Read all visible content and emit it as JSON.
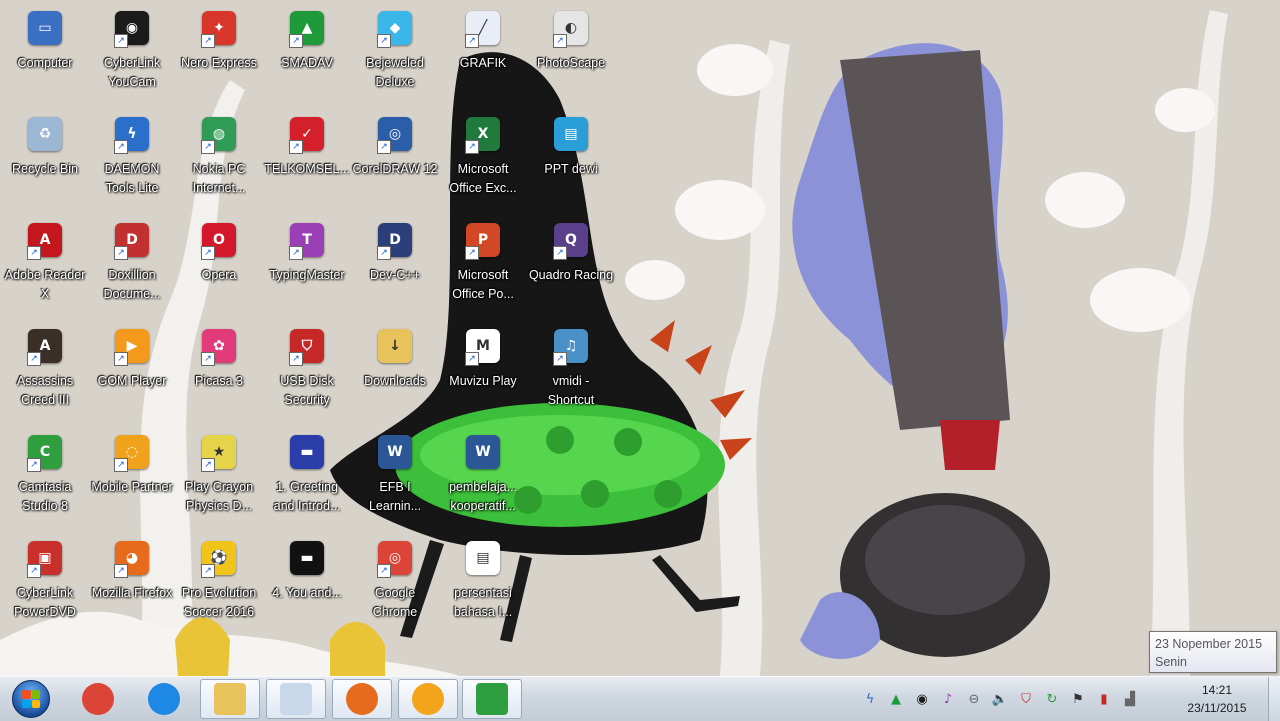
{
  "desktop": {
    "icons": [
      {
        "label": "Computer",
        "icon": "computer-icon",
        "color": "#3b6fc2",
        "glyph": "▭"
      },
      {
        "label": "CyberLink YouCam",
        "icon": "cyberlink-youcam-icon",
        "color": "#1b1b1b",
        "glyph": "◉"
      },
      {
        "label": "Nero Express",
        "icon": "nero-express-icon",
        "color": "#d8362a",
        "glyph": "✦"
      },
      {
        "label": "SMADAV",
        "icon": "smadav-icon",
        "color": "#1f9a3b",
        "glyph": "▲"
      },
      {
        "label": "Bejeweled Deluxe",
        "icon": "bejeweled-icon",
        "color": "#3bb6e8",
        "glyph": "◆"
      },
      {
        "label": "GRAFIK",
        "icon": "grafik-icon",
        "color": "#e9eef6",
        "glyph": "╱"
      },
      {
        "label": "PhotoScape",
        "icon": "photoscape-icon",
        "color": "#e5e5e5",
        "glyph": "◐"
      },
      {
        "label": "Recycle Bin",
        "icon": "recycle-bin-icon",
        "color": "#9bb7d4",
        "glyph": "♻"
      },
      {
        "label": "DAEMON Tools Lite",
        "icon": "daemon-tools-icon",
        "color": "#2a6fc9",
        "glyph": "ϟ"
      },
      {
        "label": "Nokia PC Internet...",
        "icon": "nokia-pc-icon",
        "color": "#2f9b54",
        "glyph": "◍"
      },
      {
        "label": "TELKOMSEL...",
        "icon": "telkomsel-icon",
        "color": "#d4202b",
        "glyph": "✓"
      },
      {
        "label": "CorelDRAW 12",
        "icon": "coreldraw-icon",
        "color": "#2c5da8",
        "glyph": "◎"
      },
      {
        "label": "Microsoft Office Exc...",
        "icon": "excel-icon",
        "color": "#1f7a3c",
        "glyph": "X"
      },
      {
        "label": "PPT dewi",
        "icon": "ppt-folder-icon",
        "color": "#2a9ed6",
        "glyph": "▤"
      },
      {
        "label": "Adobe Reader X",
        "icon": "adobe-reader-icon",
        "color": "#c4171d",
        "glyph": "A"
      },
      {
        "label": "Doxillion Docume...",
        "icon": "doxillion-icon",
        "color": "#c23030",
        "glyph": "D"
      },
      {
        "label": "Opera",
        "icon": "opera-icon",
        "color": "#d3182c",
        "glyph": "O"
      },
      {
        "label": "TypingMaster",
        "icon": "typingmaster-icon",
        "color": "#9b3fb7",
        "glyph": "T"
      },
      {
        "label": "Dev-C++",
        "icon": "dev-cpp-icon",
        "color": "#2b3f7a",
        "glyph": "D"
      },
      {
        "label": "Microsoft Office Po...",
        "icon": "powerpoint-icon",
        "color": "#d24726",
        "glyph": "P"
      },
      {
        "label": "Quadro Racing",
        "icon": "quadro-racing-icon",
        "color": "#5a3f8a",
        "glyph": "Q"
      },
      {
        "label": "Assassins Creed III",
        "icon": "assassins-creed-icon",
        "color": "#3a2f26",
        "glyph": "A"
      },
      {
        "label": "GOM Player",
        "icon": "gom-player-icon",
        "color": "#f39a1c",
        "glyph": "▶"
      },
      {
        "label": "Picasa 3",
        "icon": "picasa-icon",
        "color": "#e23b7a",
        "glyph": "✿"
      },
      {
        "label": "USB Disk Security",
        "icon": "usb-security-icon",
        "color": "#c62828",
        "glyph": "⛉"
      },
      {
        "label": "Downloads",
        "icon": "downloads-folder-icon",
        "color": "#e8c25a",
        "glyph": "↓"
      },
      {
        "label": "Muvizu Play",
        "icon": "muvizu-icon",
        "color": "#ffffff",
        "glyph": "M"
      },
      {
        "label": "vmidi - Shortcut",
        "icon": "vmidi-icon",
        "color": "#4a90c8",
        "glyph": "♫"
      },
      {
        "label": "Camtasia Studio 8",
        "icon": "camtasia-icon",
        "color": "#2e9e3e",
        "glyph": "C"
      },
      {
        "label": "Mobile Partner",
        "icon": "mobile-partner-icon",
        "color": "#f0a21c",
        "glyph": "◌"
      },
      {
        "label": "Play Crayon Physics D...",
        "icon": "crayon-physics-icon",
        "color": "#e5d34a",
        "glyph": "★"
      },
      {
        "label": "1. Greeting and Introd...",
        "icon": "video-file-icon",
        "color": "#2b3da8",
        "glyph": "▬"
      },
      {
        "label": "EFB I Learnin...",
        "icon": "word-doc-icon",
        "color": "#2b5797",
        "glyph": "W"
      },
      {
        "label": "pembelaja... kooperatif...",
        "icon": "word-doc-icon-2",
        "color": "#2b5797",
        "glyph": "W"
      },
      {
        "label": "CyberLink PowerDVD",
        "icon": "powerdvd-icon",
        "color": "#c9302c",
        "glyph": "▣"
      },
      {
        "label": "Mozilla Firefox",
        "icon": "firefox-icon",
        "color": "#e66b1c",
        "glyph": "◕"
      },
      {
        "label": "Pro Evolution Soccer 2016",
        "icon": "pes-2016-icon",
        "color": "#f0c419",
        "glyph": "⚽"
      },
      {
        "label": "4. You and...",
        "icon": "video-file-icon-2",
        "color": "#111111",
        "glyph": "▬"
      },
      {
        "label": "Google Chrome",
        "icon": "chrome-icon",
        "color": "#db4437",
        "glyph": "◎"
      },
      {
        "label": "persentasi bahasa I...",
        "icon": "pdf-doc-icon",
        "color": "#ffffff",
        "glyph": "▤"
      }
    ]
  },
  "taskbar": {
    "pinned": [
      {
        "name": "chrome",
        "icon": "chrome-taskbar-icon",
        "color": "#db4437"
      },
      {
        "name": "internet-explorer",
        "icon": "ie-taskbar-icon",
        "color": "#1e88e5"
      },
      {
        "name": "explorer",
        "icon": "folder-taskbar-icon",
        "color": "#e8c25a"
      },
      {
        "name": "grafik",
        "icon": "grafik-taskbar-icon",
        "color": "#c9d7ea"
      },
      {
        "name": "firefox",
        "icon": "firefox-taskbar-icon",
        "color": "#e66b1c"
      },
      {
        "name": "winamp",
        "icon": "winamp-taskbar-icon",
        "color": "#f2a51a"
      },
      {
        "name": "camtasia",
        "icon": "camtasia-taskbar-icon",
        "color": "#2e9e3e"
      }
    ],
    "tray": [
      {
        "icon": "daemon-tray-icon",
        "glyph": "ϟ",
        "color": "#2a6fc9"
      },
      {
        "icon": "smadav-tray-icon",
        "glyph": "▲",
        "color": "#1f9a3b"
      },
      {
        "icon": "youcam-tray-icon",
        "glyph": "◉",
        "color": "#1b1b1b"
      },
      {
        "icon": "typingmaster-tray-icon",
        "glyph": "♪",
        "color": "#9b3fb7"
      },
      {
        "icon": "minus-tray-icon",
        "glyph": "⊖",
        "color": "#666666"
      },
      {
        "icon": "volume-icon",
        "glyph": "🔈",
        "color": "#333333"
      },
      {
        "icon": "shield-tray-icon",
        "glyph": "⛉",
        "color": "#c62828"
      },
      {
        "icon": "sync-tray-icon",
        "glyph": "↻",
        "color": "#2e9e3e"
      },
      {
        "icon": "action-center-flag-icon",
        "glyph": "⚑",
        "color": "#333333"
      },
      {
        "icon": "battery-error-icon",
        "glyph": "▮",
        "color": "#c62828"
      },
      {
        "icon": "network-error-icon",
        "glyph": "▟",
        "color": "#666666"
      }
    ],
    "clock": {
      "time": "14:21",
      "date": "23/11/2015"
    }
  },
  "tooltip": {
    "line1": "23 Nopember 2015",
    "line2": "Senin"
  }
}
